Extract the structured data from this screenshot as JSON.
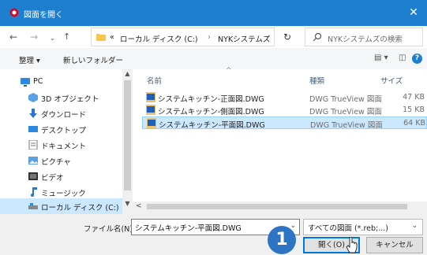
{
  "window": {
    "title": "図面を開く"
  },
  "address": {
    "prefix": "«",
    "crumbs": [
      "ローカル ディスク (C:)",
      "NYKシステムズ"
    ],
    "separator": "›"
  },
  "search": {
    "placeholder": "NYKシステムズの検索"
  },
  "toolbar": {
    "organize": "整理 ▾",
    "new_folder": "新しいフォルダー",
    "help": "?"
  },
  "sidebar": {
    "items": [
      {
        "label": "PC",
        "icon": "pc-icon"
      },
      {
        "label": "3D オブジェクト",
        "icon": "cube-3d-icon"
      },
      {
        "label": "ダウンロード",
        "icon": "download-arrow-icon"
      },
      {
        "label": "デスクトップ",
        "icon": "desktop-icon"
      },
      {
        "label": "ドキュメント",
        "icon": "document-icon"
      },
      {
        "label": "ピクチャ",
        "icon": "picture-icon"
      },
      {
        "label": "ビデオ",
        "icon": "video-icon"
      },
      {
        "label": "ミュージック",
        "icon": "music-note-icon"
      },
      {
        "label": "ローカル ディスク (C:)",
        "icon": "local-disk-icon"
      }
    ]
  },
  "columns": {
    "name": "名前",
    "type": "種類",
    "size": "サイズ"
  },
  "files": [
    {
      "name": "システムキッチン-正面図.DWG",
      "type": "DWG TrueView 図面",
      "size": "47 KB"
    },
    {
      "name": "システムキッチン-側面図.DWG",
      "type": "DWG TrueView 図面",
      "size": "15 KB"
    },
    {
      "name": "システムキッチン-平面図.DWG",
      "type": "DWG TrueView 図面",
      "size": "64 KB"
    }
  ],
  "footer": {
    "filename_label": "ファイル名(N):",
    "filename_value": "システムキッチン-平面図.DWG",
    "filetype_value": "すべての図面 (*.reb;...)",
    "open_label": "開く(O)",
    "cancel_label": "キャンセル"
  },
  "step_badge": "1",
  "colors": {
    "titlebar": "#1e7fd1",
    "selection": "#cce8ff",
    "badge": "#2d74c4",
    "folder": "#f8c84a"
  }
}
